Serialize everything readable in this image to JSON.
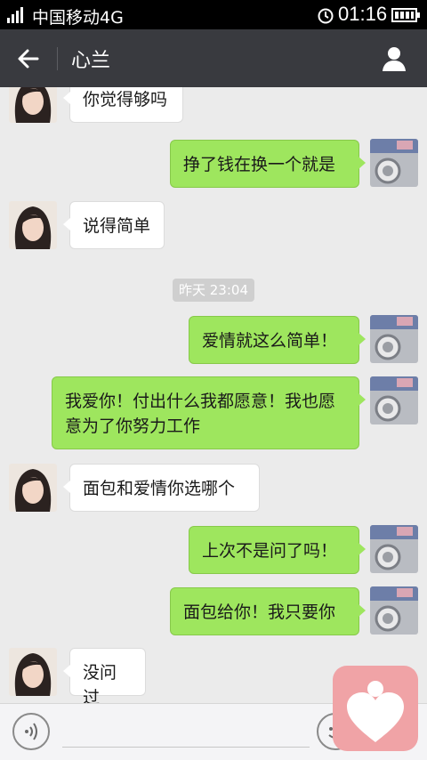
{
  "status_bar": {
    "carrier": "中国移动4G",
    "time": "01:16"
  },
  "header": {
    "contact_name": "心兰"
  },
  "messages": [
    {
      "side": "in",
      "text": "你觉得够吗"
    },
    {
      "side": "out",
      "text": "挣了钱在换一个就是"
    },
    {
      "side": "in",
      "text": "说得简单"
    },
    {
      "type": "timestamp",
      "text": "昨天 23:04"
    },
    {
      "side": "out",
      "text": "爱情就这么简单！"
    },
    {
      "side": "out",
      "text": "我爱你！付出什么我都愿意！我也愿意为了你努力工作"
    },
    {
      "side": "in",
      "text": "面包和爱情你选哪个"
    },
    {
      "side": "out",
      "text": "上次不是问了吗！"
    },
    {
      "side": "out",
      "text": "面包给你！我只要你"
    },
    {
      "side": "in",
      "text": "没问过"
    }
  ],
  "icons": {
    "back": "back-arrow-icon",
    "profile": "user-icon",
    "voice": "voice-icon",
    "emoji": "emoji-icon",
    "floating_app": "heart-app-icon"
  },
  "colors": {
    "title_bar": "#393a3f",
    "chat_bg": "#ebebeb",
    "outgoing_bubble": "#9ee65e",
    "incoming_bubble": "#ffffff",
    "floating_app": "#f0a3a6"
  }
}
